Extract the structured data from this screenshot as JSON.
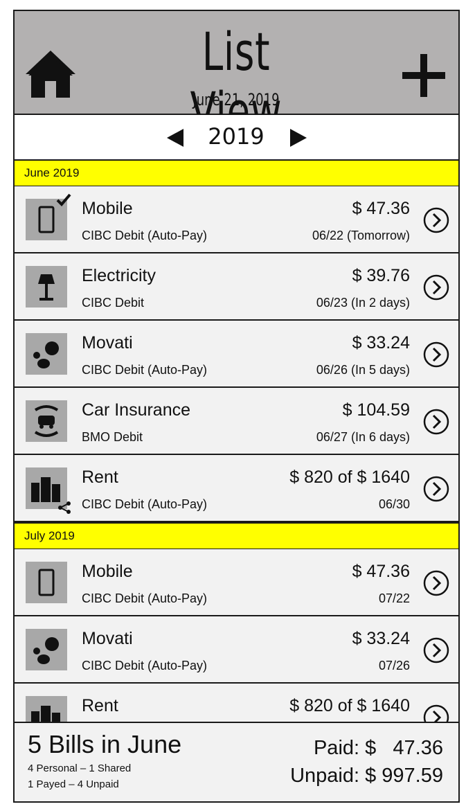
{
  "header": {
    "title": "List View",
    "date": "June 21, 2019"
  },
  "year_nav": {
    "year": "2019"
  },
  "months": [
    {
      "label": "June 2019",
      "bills": [
        {
          "icon": "mobile-phone-check-icon",
          "name": "Mobile",
          "account": "CIBC Debit (Auto-Pay)",
          "amount": "$ 47.36",
          "due": "06/22 (Tomorrow)"
        },
        {
          "icon": "lamp-icon",
          "name": "Electricity",
          "account": "CIBC Debit",
          "amount": "$ 39.76",
          "due": "06/23 (In 2 days)"
        },
        {
          "icon": "fitness-balls-icon",
          "name": "Movati",
          "account": "CIBC Debit (Auto-Pay)",
          "amount": "$ 33.24",
          "due": "06/26 (In 5 days)"
        },
        {
          "icon": "car-insurance-icon",
          "name": "Car Insurance",
          "account": "BMO Debit",
          "amount": "$ 104.59",
          "due": "06/27 (In 6 days)"
        },
        {
          "icon": "buildings-shared-icon",
          "name": "Rent",
          "account": "CIBC Debit (Auto-Pay)",
          "amount": "$ 820 of $ 1640",
          "due": "06/30"
        }
      ]
    },
    {
      "label": "July 2019",
      "bills": [
        {
          "icon": "mobile-phone-icon",
          "name": "Mobile",
          "account": "CIBC Debit (Auto-Pay)",
          "amount": "$ 47.36",
          "due": "07/22"
        },
        {
          "icon": "fitness-balls-icon",
          "name": "Movati",
          "account": "CIBC Debit (Auto-Pay)",
          "amount": "$ 33.24",
          "due": "07/26"
        },
        {
          "icon": "buildings-icon",
          "name": "Rent",
          "account": "",
          "amount": "$ 820 of $ 1640",
          "due": ""
        }
      ]
    }
  ],
  "summary": {
    "title": "5 Bills in June",
    "line1": "4 Personal – 1 Shared",
    "line2": "1 Payed – 4 Unpaid",
    "paid": "Paid: $   47.36",
    "unpaid": "Unpaid: $ 997.59"
  }
}
